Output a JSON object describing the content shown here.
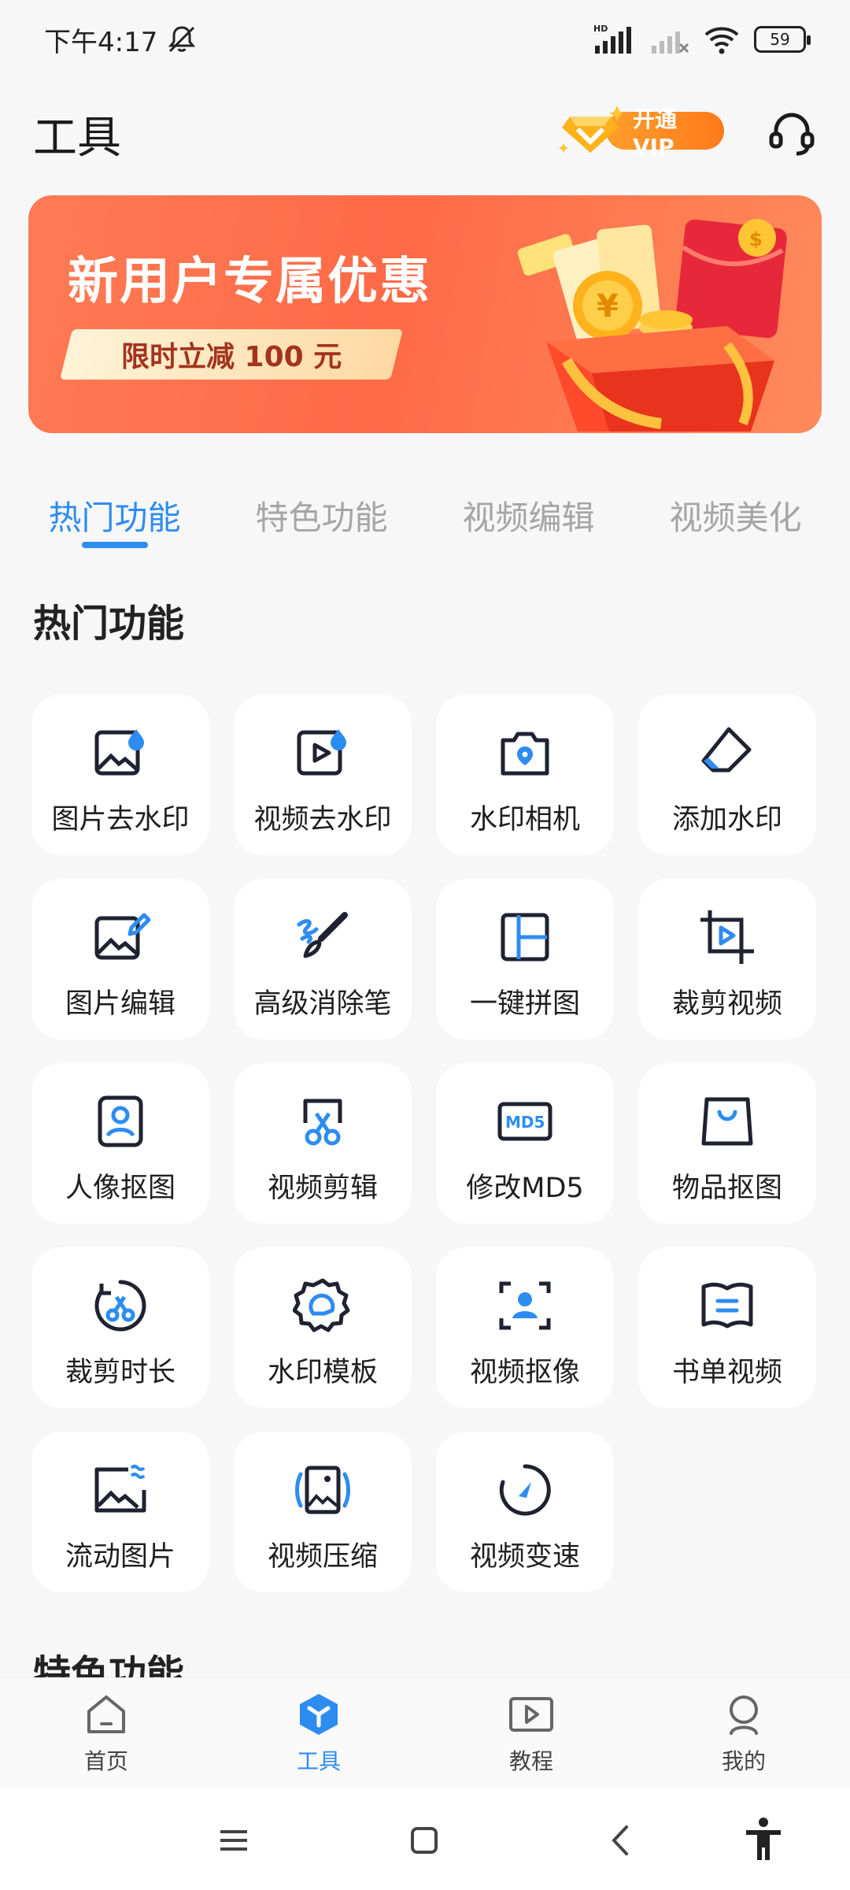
{
  "status_bar": {
    "time": "下午4:17",
    "battery": "59",
    "network_tag": "HD"
  },
  "header": {
    "title": "工具",
    "vip_label": "开通VIP"
  },
  "banner": {
    "title": "新用户专属优惠",
    "subtitle": "限时立减 100 元"
  },
  "tabs": [
    {
      "label": "热门功能",
      "active": true
    },
    {
      "label": "特色功能",
      "active": false
    },
    {
      "label": "视频编辑",
      "active": false
    },
    {
      "label": "视频美化",
      "active": false
    }
  ],
  "section_title": "热门功能",
  "next_section_title": "特色功能",
  "tools": [
    {
      "label": "图片去水印",
      "icon": "image-drop-icon"
    },
    {
      "label": "视频去水印",
      "icon": "video-drop-icon"
    },
    {
      "label": "水印相机",
      "icon": "camera-icon"
    },
    {
      "label": "添加水印",
      "icon": "add-watermark-icon"
    },
    {
      "label": "图片编辑",
      "icon": "image-edit-icon"
    },
    {
      "label": "高级消除笔",
      "icon": "brush-icon"
    },
    {
      "label": "一键拼图",
      "icon": "collage-icon"
    },
    {
      "label": "裁剪视频",
      "icon": "crop-video-icon"
    },
    {
      "label": "人像抠图",
      "icon": "portrait-icon"
    },
    {
      "label": "视频剪辑",
      "icon": "scissors-icon"
    },
    {
      "label": "修改MD5",
      "icon": "md5-icon"
    },
    {
      "label": "物品抠图",
      "icon": "bag-icon"
    },
    {
      "label": "裁剪时长",
      "icon": "trim-duration-icon"
    },
    {
      "label": "水印模板",
      "icon": "template-icon"
    },
    {
      "label": "视频抠像",
      "icon": "video-matting-icon"
    },
    {
      "label": "书单视频",
      "icon": "book-icon"
    },
    {
      "label": "流动图片",
      "icon": "flow-image-icon"
    },
    {
      "label": "视频压缩",
      "icon": "compress-icon"
    },
    {
      "label": "视频变速",
      "icon": "speed-icon"
    }
  ],
  "bottom_nav": [
    {
      "label": "首页",
      "active": false
    },
    {
      "label": "工具",
      "active": true
    },
    {
      "label": "教程",
      "active": false
    },
    {
      "label": "我的",
      "active": false
    }
  ],
  "colors": {
    "accent": "#2d8cf0",
    "banner": "#ff6a47",
    "vip": "#ff8a1f",
    "icon_dark": "#1f2230"
  }
}
